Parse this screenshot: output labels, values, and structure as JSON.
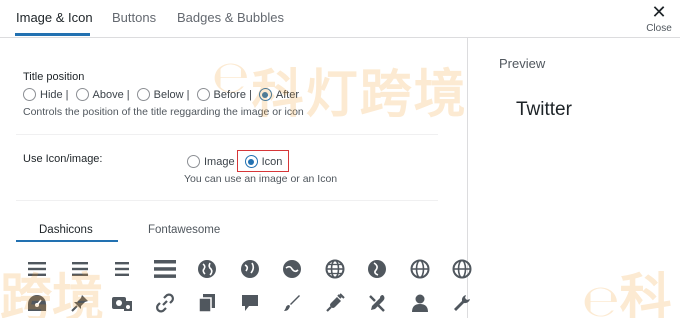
{
  "tabs": [
    {
      "label": "Image & Icon",
      "active": true
    },
    {
      "label": "Buttons",
      "active": false
    },
    {
      "label": "Badges & Bubbles",
      "active": false
    }
  ],
  "close": {
    "icon": "close-icon",
    "label": "Close"
  },
  "preview": {
    "title": "Preview",
    "text": "Twitter"
  },
  "title_position": {
    "label": "Title position",
    "options": [
      "Hide |",
      "Above |",
      "Below |",
      "Before |",
      "After"
    ],
    "selected": "After",
    "help": "Controls the position of the title reggarding the image or icon"
  },
  "use_icon": {
    "label": "Use Icon/image:",
    "options": [
      "Image",
      "Icon"
    ],
    "selected": "Icon",
    "help": "You can use an image or an Icon"
  },
  "icon_tabs": [
    {
      "label": "Dashicons",
      "active": true
    },
    {
      "label": "Fontawesome",
      "active": false
    }
  ],
  "icon_grid": {
    "row1": [
      "align-left-icon",
      "align-center-icon",
      "align-right-icon",
      "menu-icon",
      "globe-icon",
      "globe-icon",
      "globe-icon",
      "globe-icon",
      "globe-icon",
      "globe-icon",
      "globe-icon"
    ],
    "row2": [
      "dashboard-icon",
      "pin-icon",
      "media-icon",
      "link-icon",
      "copy-icon",
      "comment-icon",
      "brush-icon",
      "plugin-icon",
      "tools-icon",
      "user-icon",
      "wrench-icon"
    ]
  },
  "watermark": {
    "text": "科灯跨境",
    "text_small": "跨境",
    "text_right": "科"
  },
  "colors": {
    "accent": "#2271b1",
    "highlight": "#d63638",
    "watermark": "#f0a032"
  }
}
